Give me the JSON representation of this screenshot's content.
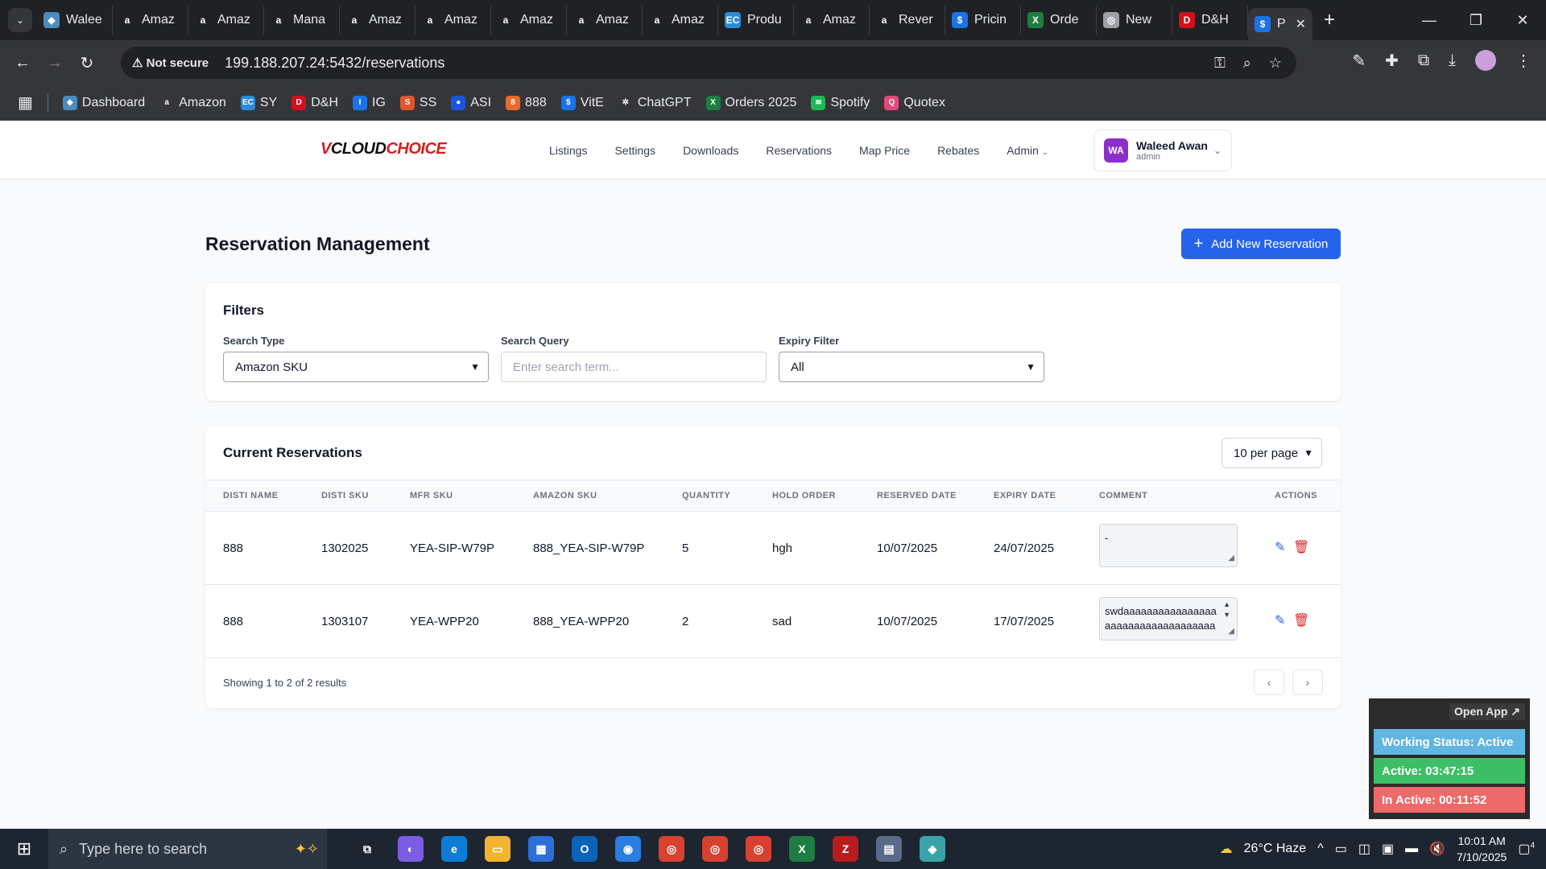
{
  "browser": {
    "tabs": [
      {
        "label": "Walee",
        "color": "#4b8bbe",
        "glyph": "◆"
      },
      {
        "label": "Amaz",
        "color": "#ffffff",
        "glyph": "a"
      },
      {
        "label": "Amaz",
        "color": "#ffffff",
        "glyph": "a"
      },
      {
        "label": "Mana",
        "color": "#ffffff",
        "glyph": "a"
      },
      {
        "label": "Amaz",
        "color": "#ffffff",
        "glyph": "a"
      },
      {
        "label": "Amaz",
        "color": "#ffffff",
        "glyph": "a"
      },
      {
        "label": "Amaz",
        "color": "#ffffff",
        "glyph": "a"
      },
      {
        "label": "Amaz",
        "color": "#ffffff",
        "glyph": "a"
      },
      {
        "label": "Amaz",
        "color": "#ffffff",
        "glyph": "a"
      },
      {
        "label": "Produ",
        "color": "#2a8bd8",
        "glyph": "EC"
      },
      {
        "label": "Amaz",
        "color": "#ffffff",
        "glyph": "a"
      },
      {
        "label": "Rever",
        "color": "#ffffff",
        "glyph": "a"
      },
      {
        "label": "Pricin",
        "color": "#1a73e8",
        "glyph": "$"
      },
      {
        "label": "Orde",
        "color": "#1d7d43",
        "glyph": "X"
      },
      {
        "label": "New",
        "color": "#9aa0a6",
        "glyph": "◎"
      },
      {
        "label": "D&H",
        "color": "#d0101a",
        "glyph": "D"
      },
      {
        "label": "P",
        "color": "#1a73e8",
        "glyph": "$"
      }
    ],
    "url_warning": "Not secure",
    "url": "199.188.207.24:5432/reservations",
    "bookmarks": [
      {
        "label": "Dashboard",
        "color": "#4b8bbe",
        "glyph": "◆"
      },
      {
        "label": "Amazon",
        "color": "#ffffff",
        "glyph": "a"
      },
      {
        "label": "SY",
        "color": "#2a8bd8",
        "glyph": "EC"
      },
      {
        "label": "D&H",
        "color": "#d0101a",
        "glyph": "D"
      },
      {
        "label": "IG",
        "color": "#1a73e8",
        "glyph": "I"
      },
      {
        "label": "SS",
        "color": "#e0562b",
        "glyph": "S"
      },
      {
        "label": "ASI",
        "color": "#1a56db",
        "glyph": "●"
      },
      {
        "label": "888",
        "color": "#e86a2b",
        "glyph": "8"
      },
      {
        "label": "VitE",
        "color": "#1a73e8",
        "glyph": "$"
      },
      {
        "label": "ChatGPT",
        "color": "#e8eaed",
        "glyph": "✲"
      },
      {
        "label": "Orders 2025",
        "color": "#1d7d43",
        "glyph": "X"
      },
      {
        "label": "Spotify",
        "color": "#1db954",
        "glyph": "≋"
      },
      {
        "label": "Quotex",
        "color": "#e5487a",
        "glyph": "Q"
      }
    ]
  },
  "app": {
    "logo_v": "V",
    "logo_cloud": "CLOUD",
    "logo_choice": "CHOICE",
    "nav": [
      "Listings",
      "Settings",
      "Downloads",
      "Reservations",
      "Map Price",
      "Rebates",
      "Admin"
    ],
    "user": {
      "initials": "WA",
      "name": "Waleed Awan",
      "role": "admin"
    }
  },
  "page": {
    "title": "Reservation Management",
    "add_button": "Add New Reservation",
    "filters": {
      "title": "Filters",
      "search_type_label": "Search Type",
      "search_type_value": "Amazon SKU",
      "search_query_label": "Search Query",
      "search_query_placeholder": "Enter search term...",
      "expiry_label": "Expiry Filter",
      "expiry_value": "All"
    },
    "reservations": {
      "title": "Current Reservations",
      "per_page": "10 per page",
      "columns": [
        "DISTI NAME",
        "DISTI SKU",
        "MFR SKU",
        "AMAZON SKU",
        "QUANTITY",
        "HOLD ORDER",
        "RESERVED DATE",
        "EXPIRY DATE",
        "COMMENT",
        "ACTIONS"
      ],
      "rows": [
        {
          "disti_name": "888",
          "disti_sku": "1302025",
          "mfr_sku": "YEA-SIP-W79P",
          "amazon_sku": "888_YEA-SIP-W79P",
          "quantity": "5",
          "hold_order": "hgh",
          "reserved_date": "10/07/2025",
          "expiry_date": "24/07/2025",
          "comment": "-"
        },
        {
          "disti_name": "888",
          "disti_sku": "1303107",
          "mfr_sku": "YEA-WPP20",
          "amazon_sku": "888_YEA-WPP20",
          "quantity": "2",
          "hold_order": "sad",
          "reserved_date": "10/07/2025",
          "expiry_date": "17/07/2025",
          "comment": "swdaaaaaaaaaaaaaaaaaaaaaaaaaaaaaaaaaaa"
        }
      ],
      "showing": "Showing 1 to 2 of 2 results"
    }
  },
  "widget": {
    "open_app": "Open App ↗",
    "working_status": "Working Status: Active",
    "active": "Active: 03:47:15",
    "inactive": "In Active: 00:11:52"
  },
  "taskbar": {
    "search_placeholder": "Type here to search",
    "weather": "26°C  Haze",
    "time": "10:01 AM",
    "date": "7/10/2025",
    "notifications": "4"
  }
}
